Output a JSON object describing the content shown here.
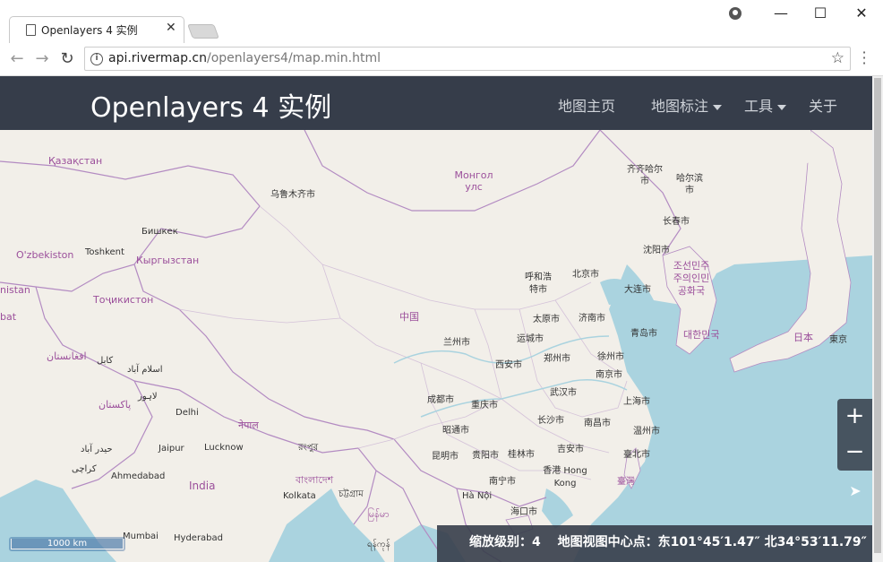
{
  "browser": {
    "tab_title": "Openlayers 4 实例",
    "url_host": "api.rivermap.cn",
    "url_path": "/openlayers4/map.min.html"
  },
  "app": {
    "brand": "Openlayers 4 实例",
    "nav": [
      {
        "label": "地图主页",
        "dropdown": false
      },
      {
        "label": "地图标注",
        "dropdown": true
      },
      {
        "label": "工具",
        "dropdown": true
      },
      {
        "label": "关于",
        "dropdown": false
      }
    ]
  },
  "map": {
    "countries": [
      "Қазақстан",
      "O'zbekiston",
      "Кыргызстан",
      "Тоҷикистон",
      "Монгол улс",
      "中国",
      "조선민주주의인민공화국",
      "대한민국",
      "日本",
      "India",
      "nistan",
      "bat",
      "افغانستان",
      "پاکستان",
      "नेपाल",
      "বাংলাদেশ",
      "မြန်မာ"
    ],
    "cities": [
      "乌鲁木齐市",
      "Бишкек",
      "Toshkent",
      "كابل",
      "اسلام آباد",
      "لاہور",
      "Delhi",
      "Jaipur",
      "Lucknow",
      "حیدر آباد",
      "کراچی",
      "Ahmedabad",
      "Mumbai",
      "Hyderabad",
      "Kolkata",
      "রংপুর",
      "চট্টগ্রাম",
      "ရန်ကုန်",
      "齐齐哈尔市",
      "哈尔滨市",
      "长春市",
      "沈阳市",
      "呼和浩特市",
      "北京市",
      "大连市",
      "太原市",
      "济南市",
      "青岛市",
      "兰州市",
      "运城市",
      "西安市",
      "郑州市",
      "徐州市",
      "南京市",
      "武汉市",
      "上海市",
      "成都市",
      "重庆市",
      "长沙市",
      "南昌市",
      "温州市",
      "昭通市",
      "昆明市",
      "贵阳市",
      "桂林市",
      "吉安市",
      "臺北市",
      "香港 Hong Kong",
      "南宁市",
      "Hà Nội",
      "海口市",
      "臺灣",
      "東京"
    ],
    "zoom_in_label": "+",
    "zoom_out_label": "−",
    "scale_label": "1000 km",
    "status_text": "缩放级别：4　 地图视图中心点：东101°45′1.47″  北34°53′11.79″"
  },
  "colors": {
    "navbar": "#363d4a",
    "land": "#f2efe9",
    "water": "#aad3df",
    "border": "#b38bc2"
  }
}
